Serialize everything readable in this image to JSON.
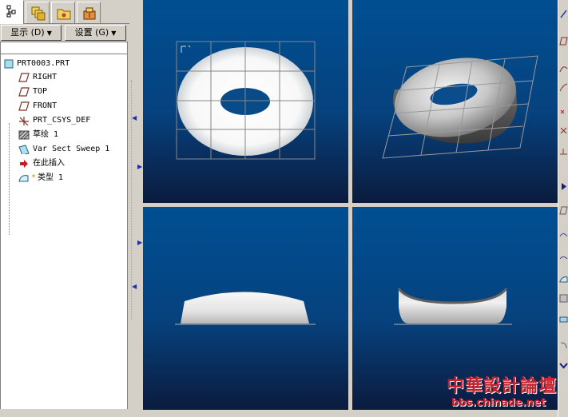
{
  "tabs": [
    {
      "icon": "model-tree-icon",
      "active": true
    },
    {
      "icon": "layers-icon",
      "active": false
    },
    {
      "icon": "folder-icon",
      "active": false
    },
    {
      "icon": "favorites-icon",
      "active": false
    }
  ],
  "buttons": {
    "show_label": "显示 (D)",
    "settings_label": "设置 (G)"
  },
  "model_tree": {
    "root": "PRT0003.PRT",
    "items": [
      {
        "label": "RIGHT",
        "icon": "datum-plane-icon"
      },
      {
        "label": "TOP",
        "icon": "datum-plane-icon"
      },
      {
        "label": "FRONT",
        "icon": "datum-plane-icon"
      },
      {
        "label": "PRT_CSYS_DEF",
        "icon": "coordinate-system-icon"
      },
      {
        "label": "草绘 1",
        "icon": "sketch-icon"
      },
      {
        "label": "Var Sect Sweep 1",
        "icon": "sweep-icon"
      },
      {
        "label": "在此插入",
        "icon": "insert-here-icon"
      },
      {
        "label": "类型 1",
        "icon": "style-feature-icon"
      }
    ]
  },
  "viewports": [
    {
      "view": "top"
    },
    {
      "view": "isometric"
    },
    {
      "view": "front"
    },
    {
      "view": "side"
    }
  ],
  "watermark": {
    "title": "中華設計論壇",
    "url": "bbs.chinade.net"
  },
  "colors": {
    "viewport_top": "#004f92",
    "viewport_bottom": "#0b1b3e",
    "watermark": "#c8202a"
  }
}
